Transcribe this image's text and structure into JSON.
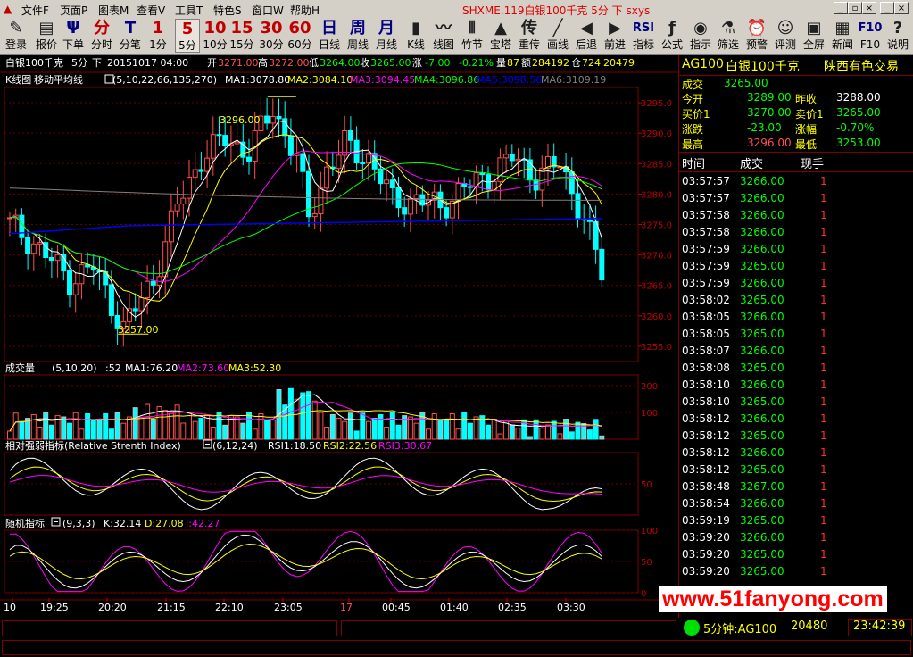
{
  "menu": {
    "items": [
      "文件F",
      "页面P",
      "图表M",
      "查看V",
      "工具T",
      "特色S",
      "窗口W",
      "帮助H"
    ],
    "title": "SHXME.119白银100千克 5分 下 sxys"
  },
  "toolbar": {
    "buttons": [
      {
        "icon": "✎",
        "label": "登录",
        "name": "login"
      },
      {
        "icon": "▤",
        "label": "报价",
        "name": "quote"
      },
      {
        "icon": "Ψ",
        "label": "下单",
        "name": "order"
      },
      {
        "icon": "分",
        "label": "分时",
        "name": "timeshare"
      },
      {
        "icon": "T",
        "label": "分笔",
        "name": "tick"
      },
      {
        "icon": "1",
        "label": "1分",
        "name": "1min"
      },
      {
        "icon": "5",
        "label": "5分",
        "name": "5min"
      },
      {
        "icon": "10",
        "label": "10分",
        "name": "10min"
      },
      {
        "icon": "15",
        "label": "15分",
        "name": "15min"
      },
      {
        "icon": "30",
        "label": "30分",
        "name": "30min"
      },
      {
        "icon": "60",
        "label": "60分",
        "name": "60min"
      },
      {
        "icon": "日",
        "label": "日线",
        "name": "daily"
      },
      {
        "icon": "周",
        "label": "周线",
        "name": "weekly"
      },
      {
        "icon": "月",
        "label": "月线",
        "name": "monthly"
      },
      {
        "icon": "▮",
        "label": "K线",
        "name": "kline"
      },
      {
        "icon": "〰",
        "label": "线图",
        "name": "linechart"
      },
      {
        "icon": "⫴",
        "label": "竹节",
        "name": "bamboo"
      },
      {
        "icon": "▲",
        "label": "宝塔",
        "name": "tower"
      },
      {
        "icon": "传",
        "label": "重传",
        "name": "retransmit"
      },
      {
        "icon": "╱",
        "label": "画线",
        "name": "draw"
      },
      {
        "icon": "◀",
        "label": "后退",
        "name": "back"
      },
      {
        "icon": "▶",
        "label": "前进",
        "name": "forward"
      },
      {
        "icon": "RSI",
        "label": "指标",
        "name": "indicator"
      },
      {
        "icon": "ƒ",
        "label": "公式",
        "name": "formula"
      },
      {
        "icon": "◉",
        "label": "指示",
        "name": "indicate"
      },
      {
        "icon": "⚗",
        "label": "筛选",
        "name": "filter"
      },
      {
        "icon": "⏰",
        "label": "预警",
        "name": "alert"
      },
      {
        "icon": "☺",
        "label": "评测",
        "name": "evaluate"
      },
      {
        "icon": "▣",
        "label": "全屏",
        "name": "fullscreen"
      },
      {
        "icon": "▦",
        "label": "新闻",
        "name": "news"
      },
      {
        "icon": "F10",
        "label": "F10",
        "name": "f10"
      },
      {
        "icon": "?",
        "label": "说明",
        "name": "help"
      }
    ],
    "active": "5min"
  },
  "info": {
    "name": "白银100千克",
    "period": "5分",
    "dir": "下",
    "datetime": "20151017 04:00",
    "open_label": "开",
    "open": "3271.00",
    "high_label": "高",
    "high": "3272.00",
    "low_label": "低",
    "low": "3264.00",
    "close_label": "收",
    "close": "3265.00",
    "chg_label": "涨",
    "chg": "-7.00",
    "chgpct": "-0.21%",
    "vol_label": "量",
    "vol": "87",
    "amt_label": "额",
    "amt": "284192",
    "oi_label": "仓",
    "oi": "724",
    "oi2": "20479"
  },
  "kline": {
    "title": "K线图",
    "ind": "移动平均线",
    "params": "(5,10,22,66,135,270)",
    "ma1": "MA1:3078.80",
    "ma2": "MA2:3084.10",
    "ma3": "MA3:3094.45",
    "ma4": "MA4:3096.86",
    "ma5": "MA5:3098.56",
    "ma6": "MA6:3109.19",
    "hi_note": "3296.00",
    "lo_note": "3257.00",
    "yticks": [
      "3295.0",
      "3290.0",
      "3285.0",
      "3280.0",
      "3275.0",
      "3270.0",
      "3265.0",
      "3260.0",
      "3255.0"
    ]
  },
  "volume": {
    "title": "成交量",
    "params": "(5,10,20)",
    "cur": ":52",
    "ma1": "MA1:76.20",
    "ma2": "MA2:73.60",
    "ma3": "MA3:52.30",
    "yticks": [
      "200",
      "100"
    ]
  },
  "rsi": {
    "title": "相对强弱指标(Relative Strenth Index)",
    "params": "(6,12,24)",
    "r1": "RSI1:18.50",
    "r2": "RSI2:22.56",
    "r3": "RSI3:30.67",
    "yticks": [
      "50"
    ]
  },
  "kdj": {
    "title": "随机指标",
    "params": "(9,3,3)",
    "k": "K:32.14",
    "d": "D:27.08",
    "j": "J:42.27",
    "yticks": [
      "100",
      "50",
      "0"
    ]
  },
  "xaxis": [
    "10",
    "19:25",
    "20:20",
    "21:15",
    "22:10",
    "23:05",
    "17",
    "00:45",
    "01:40",
    "02:35",
    "03:30"
  ],
  "right": {
    "code": "AG100",
    "name": "白银100千克",
    "exchange": "陕西有色交易",
    "last_label": "成交",
    "last": "3265.00",
    "open_label": "今开",
    "open": "3289.00",
    "prev_label": "昨收",
    "prev": "3288.00",
    "bid_label": "买价1",
    "bid": "3270.00",
    "ask_label": "卖价1",
    "ask": "3265.00",
    "chg_label": "涨跌",
    "chg": "-23.00",
    "pct_label": "涨幅",
    "pct": "-0.70%",
    "high_label": "最高",
    "high": "3296.00",
    "low_label": "最低",
    "low": "3253.00",
    "head_time": "时间",
    "head_price": "成交",
    "head_vol": "现手",
    "ticks": [
      [
        "03:57:57",
        "3266.00",
        "1"
      ],
      [
        "03:57:57",
        "3266.00",
        "1"
      ],
      [
        "03:57:58",
        "3266.00",
        "1"
      ],
      [
        "03:57:58",
        "3266.00",
        "1"
      ],
      [
        "03:57:59",
        "3266.00",
        "1"
      ],
      [
        "03:57:59",
        "3265.00",
        "1"
      ],
      [
        "03:57:59",
        "3266.00",
        "1"
      ],
      [
        "03:58:02",
        "3265.00",
        "1"
      ],
      [
        "03:58:05",
        "3266.00",
        "1"
      ],
      [
        "03:58:05",
        "3265.00",
        "1"
      ],
      [
        "03:58:07",
        "3266.00",
        "1"
      ],
      [
        "03:58:08",
        "3265.00",
        "1"
      ],
      [
        "03:58:10",
        "3266.00",
        "1"
      ],
      [
        "03:58:10",
        "3265.00",
        "1"
      ],
      [
        "03:58:12",
        "3266.00",
        "1"
      ],
      [
        "03:58:12",
        "3265.00",
        "1"
      ],
      [
        "03:58:12",
        "3266.00",
        "1"
      ],
      [
        "03:58:12",
        "3265.00",
        "1"
      ],
      [
        "03:58:48",
        "3267.00",
        "1"
      ],
      [
        "03:58:54",
        "3266.00",
        "1"
      ],
      [
        "03:59:19",
        "3265.00",
        "1"
      ],
      [
        "03:59:20",
        "3266.00",
        "1"
      ],
      [
        "03:59:20",
        "3265.00",
        "1"
      ],
      [
        "03:59:20",
        "3265.00",
        "1"
      ]
    ]
  },
  "status": {
    "conn": "5分钟:AG100",
    "count": "20480",
    "clock": "23:42:39"
  },
  "watermark": "www.51fanyong.com",
  "colors": {
    "up": "#ff5050",
    "down": "#00ffff",
    "ma1": "#ffffff",
    "ma2": "#ffff00",
    "ma3": "#ff00ff",
    "ma4": "#00ff00",
    "ma5": "#0000ff",
    "ma6": "#808080",
    "grid": "#800000",
    "axis": "#c00000"
  }
}
